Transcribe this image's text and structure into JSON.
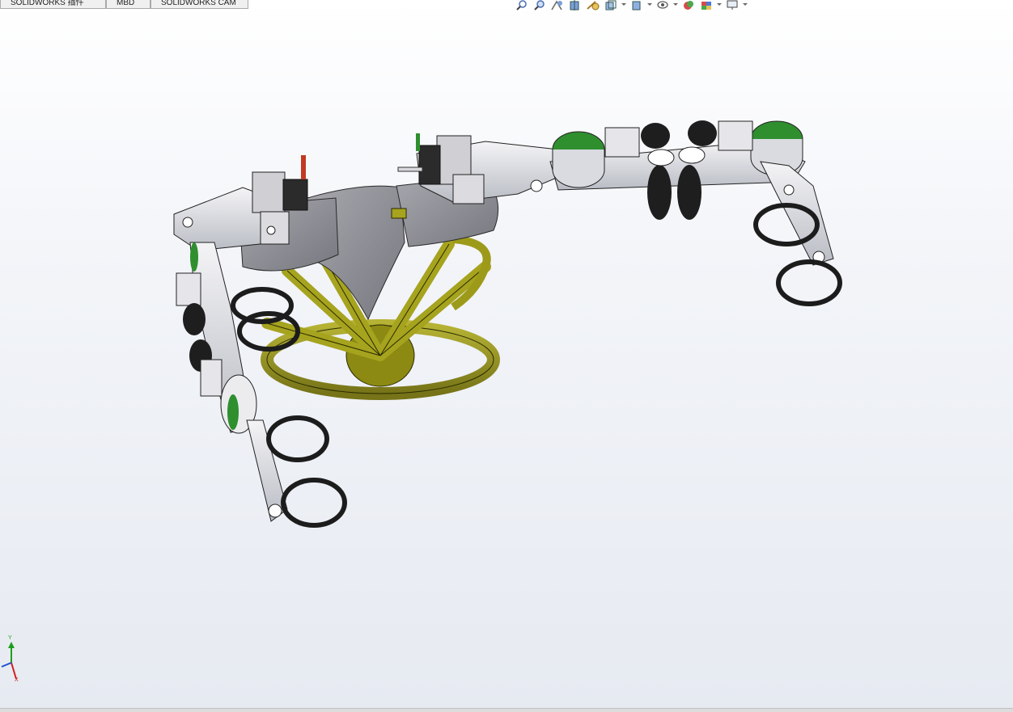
{
  "tabs": [
    {
      "label": "SOLIDWORKS 插件"
    },
    {
      "label": "MBD"
    },
    {
      "label": "SOLIDWORKS CAM"
    }
  ],
  "toolbar": {
    "icons": [
      "zoom-to-fit-icon",
      "zoom-to-area-icon",
      "previous-view-icon",
      "section-view-icon",
      "dynamic-annotation-icon",
      "view-orientation-icon",
      "display-style-icon",
      "hide-show-items-icon",
      "edit-appearance-icon",
      "apply-scene-icon",
      "view-settings-icon"
    ]
  },
  "colors": {
    "green_disc": "#2f8f2f",
    "olive_frame": "#8c8a12",
    "gray_body": "#8d8d95",
    "dark_parts": "#1c1c1c",
    "axis_y": "#1e9e1e",
    "axis_x": "#d21e1e",
    "axis_z": "#1e4fd2"
  },
  "triad": {
    "y_label": "Y",
    "x_label": "X"
  }
}
